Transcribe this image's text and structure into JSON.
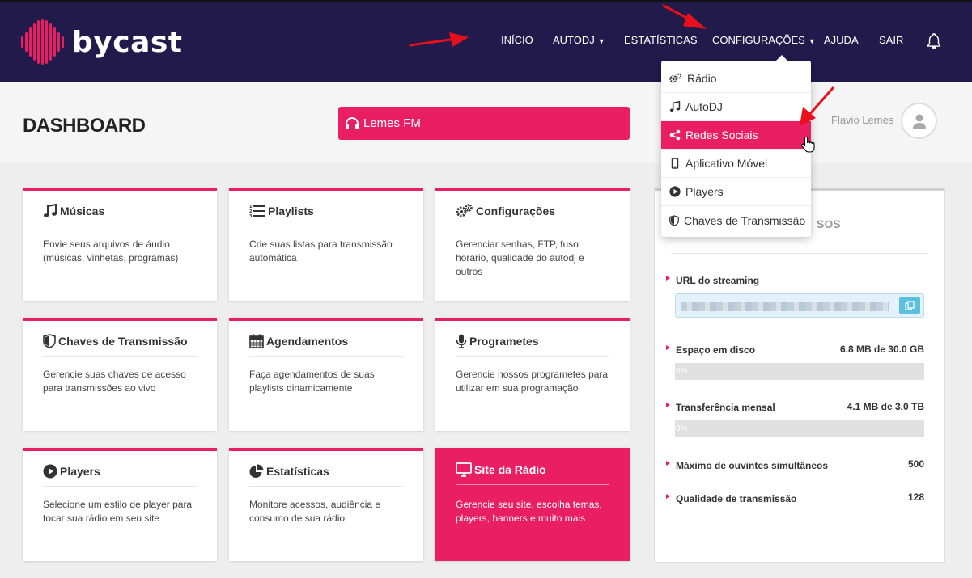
{
  "brand": {
    "name": "bycast",
    "accent": "#e91e63",
    "nav_bg": "#221a4b"
  },
  "nav": {
    "items": [
      {
        "label": "INÍCIO",
        "dropdown": false
      },
      {
        "label": "AUTODJ",
        "dropdown": true
      },
      {
        "label": "ESTATÍSTICAS",
        "dropdown": false
      },
      {
        "label": "CONFIGURAÇÕES",
        "dropdown": true
      },
      {
        "label": "AJUDA",
        "dropdown": false
      },
      {
        "label": "SAIR",
        "dropdown": false
      }
    ],
    "bell_icon": "bell-icon"
  },
  "header": {
    "title": "DASHBOARD",
    "radio_button": "Lemes FM",
    "user_name": "Flavio Lemes"
  },
  "cards": [
    {
      "title": "Músicas",
      "icon": "music-icon",
      "desc": "Envie seus arquivos de áudio (músicas, vinhetas, programas)"
    },
    {
      "title": "Playlists",
      "icon": "list-ol-icon",
      "desc": "Crie suas listas para transmissão automática"
    },
    {
      "title": "Configurações",
      "icon": "gears-icon",
      "desc": "Gerenciar senhas, FTP, fuso horário, qualidade do autodj e outros"
    },
    {
      "title": "Chaves de Transmissão",
      "icon": "shield-icon",
      "desc": "Gerencie suas chaves de acesso para transmissões ao vivo"
    },
    {
      "title": "Agendamentos",
      "icon": "calendar-icon",
      "desc": "Faça agendamentos de suas playlists dinamicamente"
    },
    {
      "title": "Programetes",
      "icon": "microphone-icon",
      "desc": "Gerencie nossos programetes para utilizar em sua programação"
    },
    {
      "title": "Players",
      "icon": "play-circle-icon",
      "desc": "Selecione um estilo de player para tocar sua rádio em seu site"
    },
    {
      "title": "Estatísticas",
      "icon": "pie-chart-icon",
      "desc": "Monitore acessos, audiência e consumo de sua rádio"
    },
    {
      "title": "Site da Rádio",
      "icon": "desktop-icon",
      "desc": "Gerencie seu site, escolha temas, players, banners e muito mais"
    }
  ],
  "resources": {
    "title_partial": "SOS",
    "url_label": "URL do streaming",
    "disk_label": "Espaço em disco",
    "disk_value": "6.8 MB de 30.0 GB",
    "disk_percent_text": "0%",
    "disk_fraction": 0.0002,
    "transfer_label": "Transferência mensal",
    "transfer_value": "4.1 MB de 3.0 TB",
    "transfer_percent_text": "0%",
    "transfer_fraction": 0.0,
    "listeners_label": "Máximo de ouvintes simultâneos",
    "listeners_value": "500",
    "quality_label": "Qualidade de transmissão",
    "quality_value": "128"
  },
  "dropdown": {
    "items": [
      {
        "label": "Rádio",
        "icon": "gears-icon"
      },
      {
        "label": "AutoDJ",
        "icon": "music-icon"
      },
      {
        "label": "Redes Sociais",
        "icon": "share-icon",
        "active": true
      },
      {
        "label": "Aplicativo Móvel",
        "icon": "mobile-icon"
      },
      {
        "label": "Players",
        "icon": "play-circle-icon"
      },
      {
        "label": "Chaves de Transmissão",
        "icon": "shield-icon"
      }
    ]
  }
}
